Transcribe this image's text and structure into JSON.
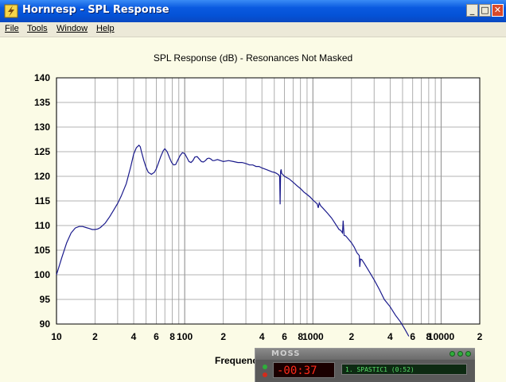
{
  "window": {
    "title": "Hornresp - SPL Response",
    "minimize_glyph": "_",
    "maximize_glyph": "□",
    "close_glyph": "✕",
    "icon": "lightning-icon"
  },
  "menu": [
    {
      "label": "File"
    },
    {
      "label": "Tools"
    },
    {
      "label": "Window"
    },
    {
      "label": "Help"
    }
  ],
  "colors": {
    "titlebar": "#0a5ae0",
    "plot_bg": "#ffffff",
    "page_bg": "#fbfbe6",
    "grid": "#9a9a9a",
    "curve": "#1a1a8c",
    "close_button": "#d9492a"
  },
  "chart_data": {
    "type": "line",
    "title": "SPL Response (dB) - Resonances Not Masked",
    "xlabel": "Frequenc",
    "ylabel": "",
    "x_scale": "log",
    "xlim": [
      10,
      20000
    ],
    "ylim": [
      90,
      140
    ],
    "grid": true,
    "y_ticks": [
      "140",
      "135",
      "130",
      "125",
      "120",
      "115",
      "110",
      "105",
      "100",
      "95",
      "90"
    ],
    "x_ticks": [
      {
        "value": 10,
        "label": "10"
      },
      {
        "value": 20,
        "label": "2"
      },
      {
        "value": 40,
        "label": "4"
      },
      {
        "value": 60,
        "label": "6"
      },
      {
        "value": 80,
        "label": "8"
      },
      {
        "value": 100,
        "label": "100"
      },
      {
        "value": 200,
        "label": "2"
      },
      {
        "value": 400,
        "label": "4"
      },
      {
        "value": 600,
        "label": "6"
      },
      {
        "value": 800,
        "label": "8"
      },
      {
        "value": 1000,
        "label": "1000"
      },
      {
        "value": 2000,
        "label": "2"
      },
      {
        "value": 4000,
        "label": "4"
      },
      {
        "value": 6000,
        "label": "6"
      },
      {
        "value": 8000,
        "label": "8"
      },
      {
        "value": 10000,
        "label": "10000"
      },
      {
        "value": 20000,
        "label": "2"
      }
    ],
    "series": [
      {
        "x": [
          10,
          11,
          12,
          13,
          14,
          15,
          16,
          17,
          18,
          19,
          20,
          21,
          22,
          24,
          26,
          28,
          30,
          32,
          35,
          38,
          40,
          42,
          44,
          45,
          46,
          48,
          50,
          52,
          55,
          58,
          60,
          62,
          65,
          68,
          70,
          73,
          76,
          79,
          82,
          85,
          88,
          92,
          96,
          100,
          104,
          108,
          112,
          116,
          120,
          125,
          130,
          135,
          140,
          145,
          150,
          155,
          160,
          165,
          170,
          180,
          190,
          200,
          210,
          220,
          240,
          260,
          280,
          300,
          320,
          340,
          360,
          380,
          400,
          420,
          440,
          460,
          480,
          500,
          520,
          540,
          550,
          555,
          560,
          565,
          570,
          580,
          600,
          650,
          700,
          750,
          800,
          850,
          900,
          950,
          1000,
          1050,
          1080,
          1100,
          1120,
          1150,
          1200,
          1300,
          1400,
          1500,
          1600,
          1650,
          1700,
          1720,
          1750,
          1800,
          1900,
          2000,
          2100,
          2200,
          2250,
          2300,
          2320,
          2350,
          2400,
          2500,
          2700,
          3000,
          3300,
          3600,
          4000,
          4400,
          4800,
          5200,
          5600
        ],
        "y": [
          100.0,
          103.5,
          106.5,
          108.5,
          109.5,
          109.8,
          109.8,
          109.6,
          109.4,
          109.2,
          109.2,
          109.3,
          109.6,
          110.5,
          111.8,
          113.2,
          114.5,
          116.0,
          118.5,
          122.0,
          124.5,
          125.8,
          126.3,
          126.0,
          125.0,
          123.2,
          121.8,
          120.8,
          120.4,
          120.8,
          121.5,
          122.5,
          124.0,
          125.2,
          125.6,
          125.0,
          123.8,
          122.8,
          122.3,
          122.4,
          123.2,
          124.2,
          124.8,
          124.6,
          123.8,
          123.0,
          122.8,
          123.2,
          123.9,
          124.0,
          123.5,
          123.0,
          122.9,
          123.2,
          123.6,
          123.7,
          123.5,
          123.2,
          123.2,
          123.4,
          123.2,
          123.0,
          123.1,
          123.2,
          123.0,
          122.8,
          122.8,
          122.6,
          122.3,
          122.3,
          122.0,
          122.0,
          121.7,
          121.5,
          121.3,
          121.1,
          120.9,
          120.8,
          120.6,
          120.3,
          120.0,
          114.3,
          121.0,
          121.4,
          120.6,
          120.4,
          120.0,
          119.5,
          118.8,
          118.1,
          117.5,
          116.8,
          116.3,
          115.8,
          115.2,
          114.7,
          114.4,
          113.6,
          114.6,
          114.0,
          113.5,
          112.5,
          111.5,
          110.3,
          109.2,
          109.0,
          108.5,
          111.0,
          108.0,
          107.9,
          107.2,
          106.5,
          105.6,
          104.5,
          104.2,
          103.9,
          101.6,
          103.2,
          103.1,
          102.4,
          101.0,
          99.0,
          97.0,
          95.0,
          93.5,
          91.8,
          90.5,
          89.0,
          87.5
        ]
      }
    ]
  },
  "moss_player": {
    "logo": "MOSS",
    "time": "-00:37",
    "track": "1. SPASTIC1 (0:52)"
  }
}
